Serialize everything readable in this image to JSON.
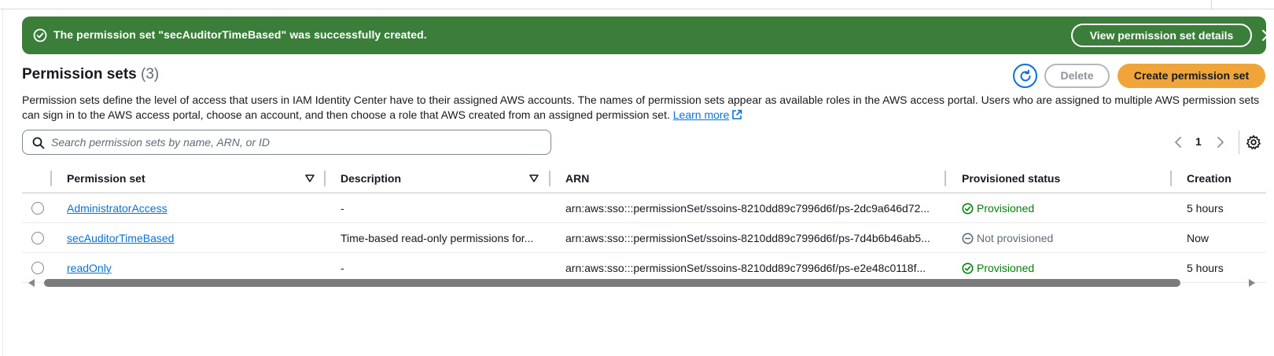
{
  "flash": {
    "message": "The permission set \"secAuditorTimeBased\" was successfully created.",
    "view_button": "View permission set details",
    "color": "#3a7e3a"
  },
  "header": {
    "title": "Permission sets",
    "count": "(3)",
    "delete_label": "Delete",
    "create_label": "Create permission set",
    "description": "Permission sets define the level of access that users in IAM Identity Center have to their assigned AWS accounts. The names of permission sets appear as available roles in the AWS access portal. Users who are assigned to multiple AWS permission sets can sign in to the AWS access portal, choose an account, and then choose a role that AWS created from an assigned permission set.",
    "learn_more": "Learn more"
  },
  "search": {
    "placeholder": "Search permission sets by name, ARN, or ID",
    "value": ""
  },
  "pagination": {
    "current_page": "1"
  },
  "table": {
    "columns": [
      "Permission set",
      "Description",
      "ARN",
      "Provisioned status",
      "Creation"
    ],
    "rows": [
      {
        "name": "AdministratorAccess",
        "description": "-",
        "arn": "arn:aws:sso:::permissionSet/ssoins-8210dd89c7996d6f/ps-2dc9a646d72...",
        "status": "Provisioned",
        "created": "5 hours"
      },
      {
        "name": "secAuditorTimeBased",
        "description": "Time-based read-only permissions for...",
        "arn": "arn:aws:sso:::permissionSet/ssoins-8210dd89c7996d6f/ps-7d4b6b46ab5...",
        "status": "Not provisioned",
        "created": "Now"
      },
      {
        "name": "readOnly",
        "description": "-",
        "arn": "arn:aws:sso:::permissionSet/ssoins-8210dd89c7996d6f/ps-e2e48c0118f...",
        "status": "Provisioned",
        "created": "5 hours"
      }
    ]
  },
  "colors": {
    "link": "#0972d3",
    "primary_button": "#f0a53a",
    "success": "#037f0c",
    "muted": "#5f6b7a"
  }
}
